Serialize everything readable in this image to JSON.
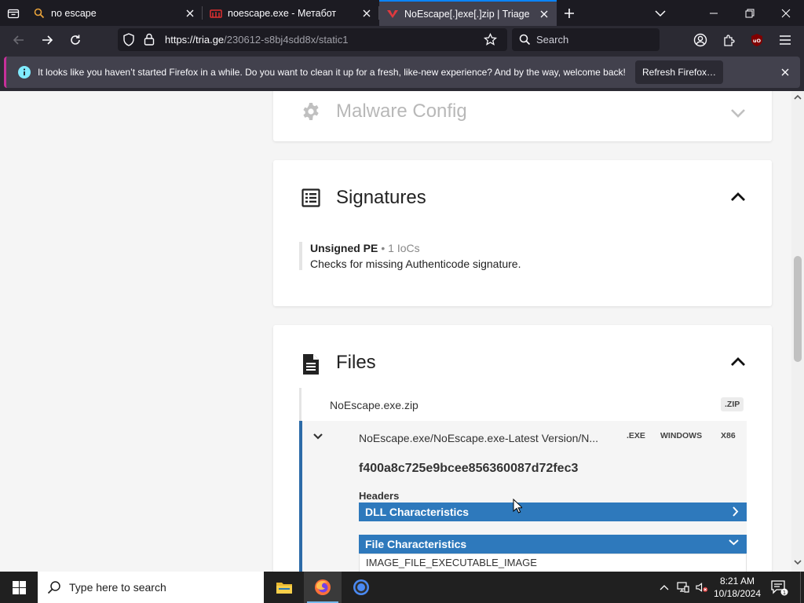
{
  "browser": {
    "tabs": [
      {
        "title": "no escape",
        "icon": "search-icon",
        "active": false
      },
      {
        "title": "noescape.exe - Метабот",
        "icon": "metabot-icon",
        "active": false
      },
      {
        "title": "NoEscape[.]exe[.]zip | Triage",
        "icon": "triage-icon",
        "active": true
      }
    ],
    "url": {
      "host": "https://tria.ge",
      "path": "/230612-s8bj4sdd8x/static1"
    },
    "search_placeholder": "Search",
    "accent": "#0a84ff"
  },
  "notification": {
    "message": "It looks like you haven’t started Firefox in a while. Do you want to clean it up for a fresh, like-new experience? And by the way, welcome back!",
    "button": "Refresh Firefox…",
    "accent": "#c7309a"
  },
  "page": {
    "malware_config": {
      "title": "Malware Config",
      "icon": "gear-icon"
    },
    "signatures": {
      "title": "Signatures",
      "icon": "list-icon",
      "items": [
        {
          "name": "Unsigned PE",
          "iocs": "• 1 IoCs",
          "description": "Checks for missing Authenticode signature."
        }
      ]
    },
    "files": {
      "title": "Files",
      "icon": "file-icon",
      "archive": {
        "name": "NoEscape.exe.zip",
        "tag": ".ZIP"
      },
      "executable": {
        "name": "NoEscape.exe/NoEscape.exe-Latest Version/N...",
        "tags": [
          ".EXE",
          "WINDOWS",
          "X86"
        ],
        "hash": "f400a8c725e9bcee856360087d72fec3",
        "headers_label": "Headers",
        "sections": [
          {
            "label": "DLL Characteristics",
            "expanded": false
          },
          {
            "label": "File Characteristics",
            "expanded": true,
            "items": [
              "IMAGE_FILE_EXECUTABLE_IMAGE"
            ]
          }
        ],
        "accent": "#2e79bc"
      }
    }
  },
  "taskbar": {
    "search_placeholder": "Type here to search",
    "apps": [
      "file-explorer-icon",
      "firefox-icon",
      "chrome-icon"
    ],
    "time": "8:21 AM",
    "date": "10/18/2024",
    "notification_count": "1"
  }
}
